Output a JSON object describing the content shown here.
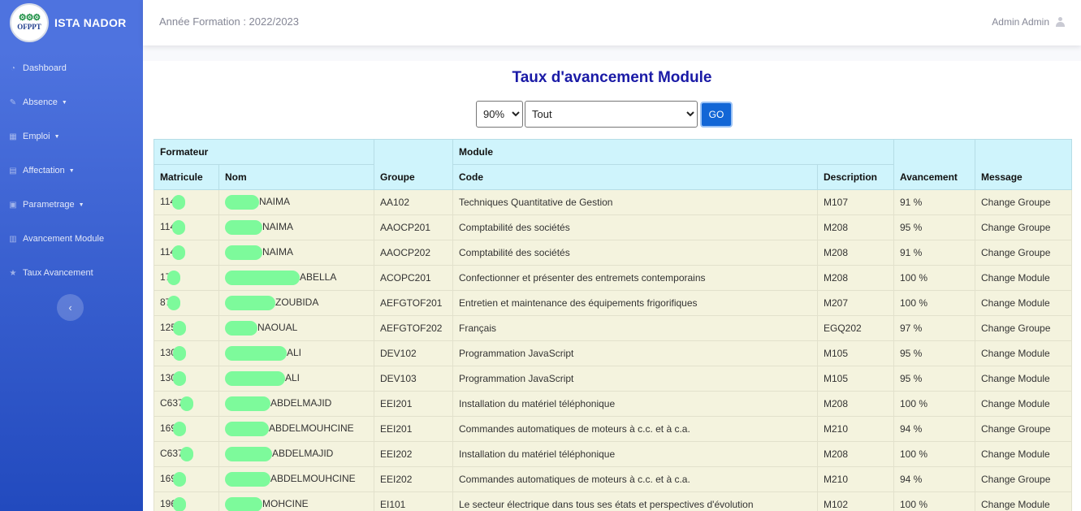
{
  "sidebar": {
    "brand": "ISTA NADOR",
    "logo_text": "OFPPT",
    "items": [
      {
        "label": "Dashboard",
        "icon": "dashboard-icon",
        "caret": false
      },
      {
        "label": "Absence",
        "icon": "pencil-icon",
        "caret": true
      },
      {
        "label": "Emploi",
        "icon": "table-icon",
        "caret": true
      },
      {
        "label": "Affectation",
        "icon": "clipboard-icon",
        "caret": true
      },
      {
        "label": "Parametrage",
        "icon": "calendar-icon",
        "caret": true
      },
      {
        "label": "Avancement Module",
        "icon": "file-icon",
        "caret": false
      },
      {
        "label": "Taux Avancement",
        "icon": "star-icon",
        "caret": false
      }
    ]
  },
  "topbar": {
    "year": "Année Formation : 2022/2023",
    "user": "Admin Admin"
  },
  "main": {
    "title": "Taux d'avancement Module",
    "filter_percent": "90%",
    "filter_group": "Tout",
    "go_label": "GO"
  },
  "table": {
    "group_headers": {
      "formateur": "Formateur",
      "module": "Module"
    },
    "headers": {
      "matricule": "Matricule",
      "nom": "Nom",
      "groupe": "Groupe",
      "code": "Code",
      "description": "Description",
      "avancement": "Avancement",
      "message": "Message"
    },
    "rows": [
      {
        "matricule": "114",
        "nom": "NAIMA",
        "groupe": "AA102",
        "code": "Techniques Quantitative de Gestion",
        "description": "M107",
        "avancement": "91 %",
        "message": "Change Groupe"
      },
      {
        "matricule": "114",
        "nom": "NAIMA",
        "groupe": "AAOCP201",
        "code": "Comptabilité des sociétés",
        "description": "M208",
        "avancement": "95 %",
        "message": "Change Groupe"
      },
      {
        "matricule": "114",
        "nom": "NAIMA",
        "groupe": "AAOCP202",
        "code": "Comptabilité des sociétés",
        "description": "M208",
        "avancement": "91 %",
        "message": "Change Groupe"
      },
      {
        "matricule": "17",
        "nom": "ABELLA",
        "groupe": "ACOPC201",
        "code": "Confectionner et présenter des entremets contemporains",
        "description": "M208",
        "avancement": "100 %",
        "message": "Change Module"
      },
      {
        "matricule": "87",
        "nom": "ZOUBIDA",
        "groupe": "AEFGTOF201",
        "code": "Entretien et maintenance des équipements frigorifiques",
        "description": "M207",
        "avancement": "100 %",
        "message": "Change Module"
      },
      {
        "matricule": "125",
        "nom": "NAOUAL",
        "groupe": "AEFGTOF202",
        "code": "Français",
        "description": "EGQ202",
        "avancement": "97 %",
        "message": "Change Groupe"
      },
      {
        "matricule": "130",
        "nom": "ALI",
        "groupe": "DEV102",
        "code": "Programmation JavaScript",
        "description": "M105",
        "avancement": "95 %",
        "message": "Change Module"
      },
      {
        "matricule": "130",
        "nom": "ALI",
        "groupe": "DEV103",
        "code": "Programmation JavaScript",
        "description": "M105",
        "avancement": "95 %",
        "message": "Change Module"
      },
      {
        "matricule": "C637",
        "nom": "ABDELMAJID",
        "groupe": "EEI201",
        "code": "Installation du matériel téléphonique",
        "description": "M208",
        "avancement": "100 %",
        "message": "Change Module"
      },
      {
        "matricule": "169",
        "nom": "ABDELMOUHCINE",
        "groupe": "EEI201",
        "code": "Commandes automatiques de moteurs à c.c. et à c.a.",
        "description": "M210",
        "avancement": "94 %",
        "message": "Change Groupe"
      },
      {
        "matricule": "C637",
        "nom": "ABDELMAJID",
        "groupe": "EEI202",
        "code": "Installation du matériel téléphonique",
        "description": "M208",
        "avancement": "100 %",
        "message": "Change Module"
      },
      {
        "matricule": "169",
        "nom": "ABDELMOUHCINE",
        "groupe": "EEI202",
        "code": "Commandes automatiques de moteurs à c.c. et à c.a.",
        "description": "M210",
        "avancement": "94 %",
        "message": "Change Groupe"
      },
      {
        "matricule": "196",
        "nom": "MOHCINE",
        "groupe": "EI101",
        "code": "Le secteur électrique dans tous ses états et perspectives d'évolution",
        "description": "M102",
        "avancement": "100 %",
        "message": "Change Module"
      }
    ]
  }
}
